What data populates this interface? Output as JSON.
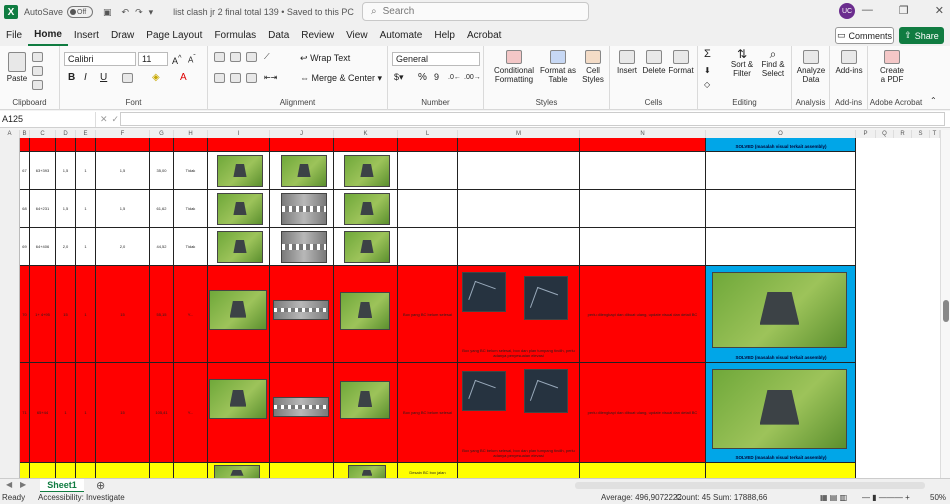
{
  "titlebar": {
    "autosave_label": "AutoSave",
    "autosave_state": "Off",
    "doc_title": "list clash jr 2 final total 139 • Saved to this PC",
    "search_placeholder": "Search",
    "user_initials": "UC"
  },
  "menu": [
    "File",
    "Home",
    "Insert",
    "Draw",
    "Page Layout",
    "Formulas",
    "Data",
    "Review",
    "View",
    "Automate",
    "Help",
    "Acrobat"
  ],
  "menu_active": "Home",
  "comments_label": "Comments",
  "share_label": "Share",
  "ribbon": {
    "clipboard": {
      "paste": "Paste",
      "label": "Clipboard"
    },
    "font": {
      "name": "Calibri",
      "size": "11",
      "label": "Font"
    },
    "alignment": {
      "wrap": "Wrap Text",
      "merge": "Merge & Center",
      "label": "Alignment"
    },
    "number": {
      "format": "General",
      "label": "Number"
    },
    "styles": {
      "cond": [
        "Conditional",
        "Formatting"
      ],
      "table": [
        "Format as",
        "Table"
      ],
      "cell": [
        "Cell",
        "Styles"
      ],
      "label": "Styles"
    },
    "cells": {
      "insert": "Insert",
      "delete": "Delete",
      "format": "Format",
      "label": "Cells"
    },
    "editing": {
      "sort": [
        "Sort &",
        "Filter"
      ],
      "find": [
        "Find &",
        "Select"
      ],
      "label": "Editing"
    },
    "analysis": {
      "analyze": [
        "Analyze",
        "Data"
      ],
      "label": "Analysis"
    },
    "addins": {
      "btn": "Add-ins",
      "label": "Add-ins"
    },
    "acrobat": {
      "create": [
        "Create",
        "a PDF"
      ],
      "label": "Adobe Acrobat"
    }
  },
  "formula_bar": {
    "name_box": "A125",
    "fx": "fx"
  },
  "columns": [
    "A",
    "B",
    "C",
    "D",
    "E",
    "F",
    "G",
    "H",
    "I",
    "J",
    "K",
    "L",
    "M",
    "N",
    "O",
    "P",
    "Q",
    "R",
    "S",
    "T"
  ],
  "rows": [
    {
      "num": "67",
      "id": "63+393",
      "d": "1,5",
      "e": "1",
      "f": "1,5",
      "g": "35,00",
      "h": "Tidak"
    },
    {
      "num": "68",
      "id": "64+231",
      "d": "1,5",
      "e": "1",
      "f": "1,5",
      "g": "61,62",
      "h": "Tidak"
    },
    {
      "num": "69",
      "id": "64+406",
      "d": "2,0",
      "e": "1",
      "f": "2,0",
      "g": "44,52",
      "h": "Tidak"
    },
    {
      "num": "70",
      "id": "1+ 4+95",
      "d": "15",
      "e": "1",
      "f": "15",
      "g": "55,15",
      "h": "Y..."
    },
    {
      "num": "71",
      "id": "65+44",
      "d": "1",
      "e": "1",
      "f": "15",
      "g": "105,41",
      "h": "Y..."
    }
  ],
  "cell_text": {
    "solved": "SOLVED (masalah visual terkait assembly)",
    "l_note": "Box yang BC belum selesai",
    "m_note": "Box yang BC belum selesai, box dan plan tumpang tindih, perlu adanya penyesuaian elevasi",
    "n_note": "perlu dilengkapi dan dibuat ulang, update visual dan detail BC",
    "l_next": "Desain BC box jalan"
  },
  "sheet_tab": "Sheet1",
  "status": {
    "ready": "Ready",
    "accessibility": "Accessibility: Investigate",
    "average": "Average: 496,9072222",
    "count": "Count: 45",
    "sum": "Sum: 17888,66",
    "zoom": "50%"
  }
}
